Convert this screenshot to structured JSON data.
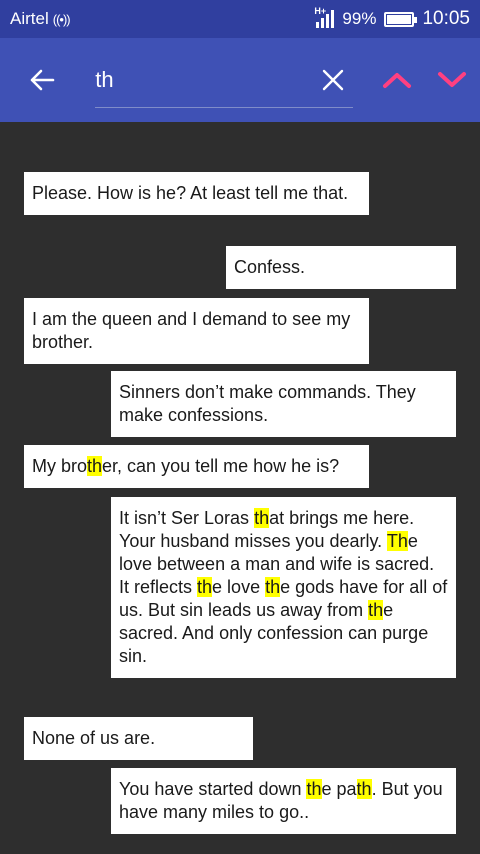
{
  "status_bar": {
    "carrier": "Airtel",
    "network": "H+",
    "battery": "99%",
    "battery_level": 0.99,
    "time": "10:05"
  },
  "search": {
    "query": "th",
    "colors": {
      "toolbar": "#3f51b5",
      "status": "#303f9f",
      "nav_arrows": "#ff4081"
    }
  },
  "highlight_color": "#ffff00",
  "messages": [
    {
      "side": "left",
      "segments": [
        {
          "t": "Please. How is he? At least tell me that."
        }
      ]
    },
    {
      "side": "right",
      "segments": [
        {
          "t": "Confess."
        }
      ]
    },
    {
      "side": "left",
      "segments": [
        {
          "t": "I am the queen and I demand to see my brother."
        }
      ]
    },
    {
      "side": "right",
      "segments": [
        {
          "t": "Sinners don’t make commands. They make confessions."
        }
      ]
    },
    {
      "side": "left",
      "segments": [
        {
          "t": "My bro"
        },
        {
          "t": "th",
          "hl": true
        },
        {
          "t": "er, can you tell me how he is?"
        }
      ]
    },
    {
      "side": "right",
      "segments": [
        {
          "t": "It isn’t Ser Loras "
        },
        {
          "t": "th",
          "hl": true
        },
        {
          "t": "at brings me here. Your husband misses you dearly. "
        },
        {
          "t": "Th",
          "hl": true
        },
        {
          "t": "e love between a man and wife is sacred. It reflects "
        },
        {
          "t": "th",
          "hl": true
        },
        {
          "t": "e love "
        },
        {
          "t": "th",
          "hl": true
        },
        {
          "t": "e gods have for all of us. But sin leads us away from "
        },
        {
          "t": "th",
          "hl": true
        },
        {
          "t": "e sacred. And only confession can purge sin."
        }
      ]
    },
    {
      "side": "left",
      "segments": [
        {
          "t": "None of us are."
        }
      ]
    },
    {
      "side": "right",
      "segments": [
        {
          "t": "You have started down "
        },
        {
          "t": "th",
          "hl": true
        },
        {
          "t": "e pa"
        },
        {
          "t": "th",
          "hl": true
        },
        {
          "t": ". But you have many miles to go.."
        }
      ]
    }
  ]
}
